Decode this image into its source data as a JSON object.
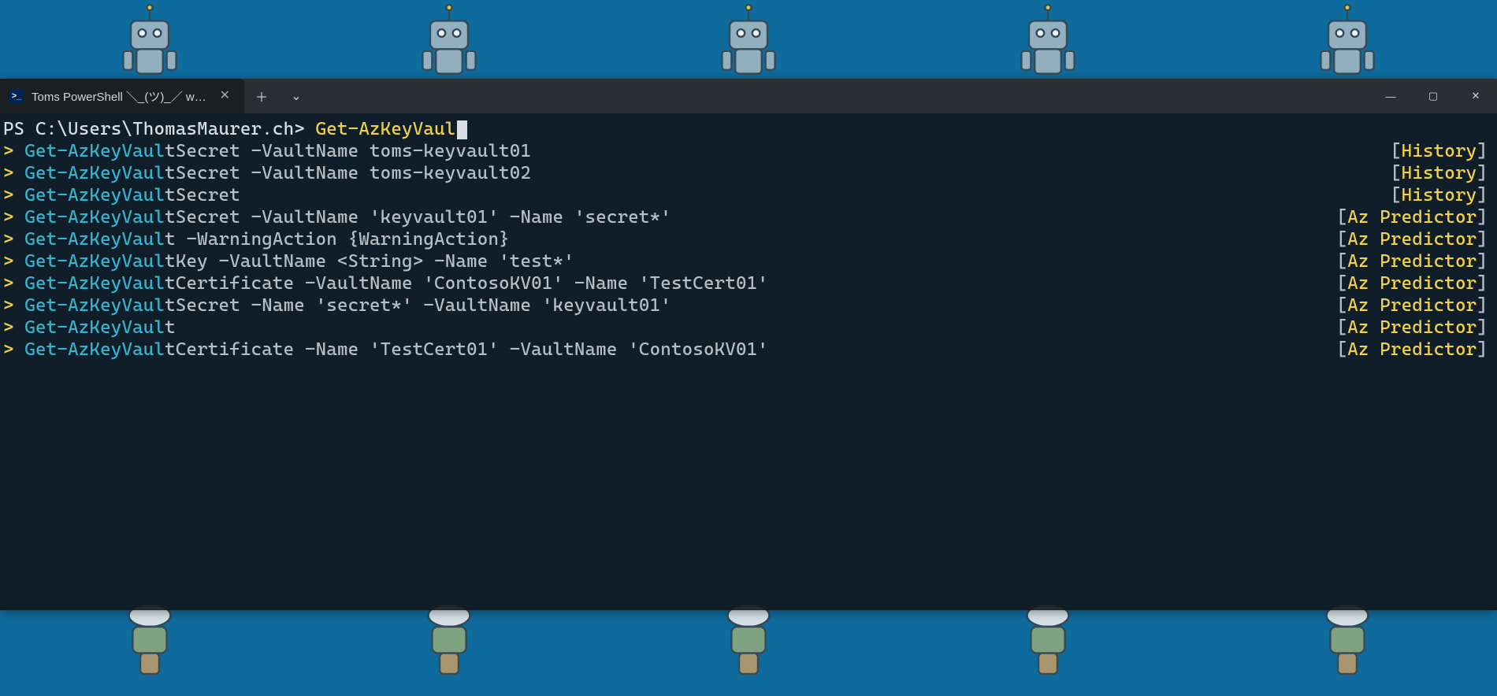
{
  "window": {
    "tab_title": "Toms PowerShell ＼_(ツ)_／ www",
    "tab_icon_glyph": ">_",
    "tab_close": "✕",
    "new_tab": "＋",
    "tab_dropdown": "⌄",
    "minimize": "—",
    "maximize": "▢",
    "close": "✕"
  },
  "prompt": {
    "prefix": "PS C:\\Users\\ThomasMaurer.ch> ",
    "typed": "Get-AzKeyVaul"
  },
  "source_labels": {
    "history": "History",
    "az_predictor": "Az Predictor"
  },
  "suggestions": [
    {
      "cmd": "Get-AzKeyVaul",
      "rest": "tSecret -VaultName toms-keyvault01",
      "src": "history"
    },
    {
      "cmd": "Get-AzKeyVaul",
      "rest": "tSecret -VaultName toms-keyvault02",
      "src": "history"
    },
    {
      "cmd": "Get-AzKeyVaul",
      "rest": "tSecret",
      "src": "history"
    },
    {
      "cmd": "Get-AzKeyVaul",
      "rest": "tSecret -VaultName 'keyvault01' -Name 'secret*'",
      "src": "az_predictor"
    },
    {
      "cmd": "Get-AzKeyVaul",
      "rest": "t -WarningAction {WarningAction}",
      "src": "az_predictor"
    },
    {
      "cmd": "Get-AzKeyVaul",
      "rest": "tKey -VaultName <String> -Name 'test*'",
      "src": "az_predictor"
    },
    {
      "cmd": "Get-AzKeyVaul",
      "rest": "tCertificate -VaultName 'ContosoKV01' -Name 'TestCert01'",
      "src": "az_predictor"
    },
    {
      "cmd": "Get-AzKeyVaul",
      "rest": "tSecret -Name 'secret*' -VaultName 'keyvault01'",
      "src": "az_predictor"
    },
    {
      "cmd": "Get-AzKeyVaul",
      "rest": "t",
      "src": "az_predictor"
    },
    {
      "cmd": "Get-AzKeyVaul",
      "rest": "tCertificate -Name 'TestCert01' -VaultName 'ContosoKV01'",
      "src": "az_predictor"
    }
  ]
}
